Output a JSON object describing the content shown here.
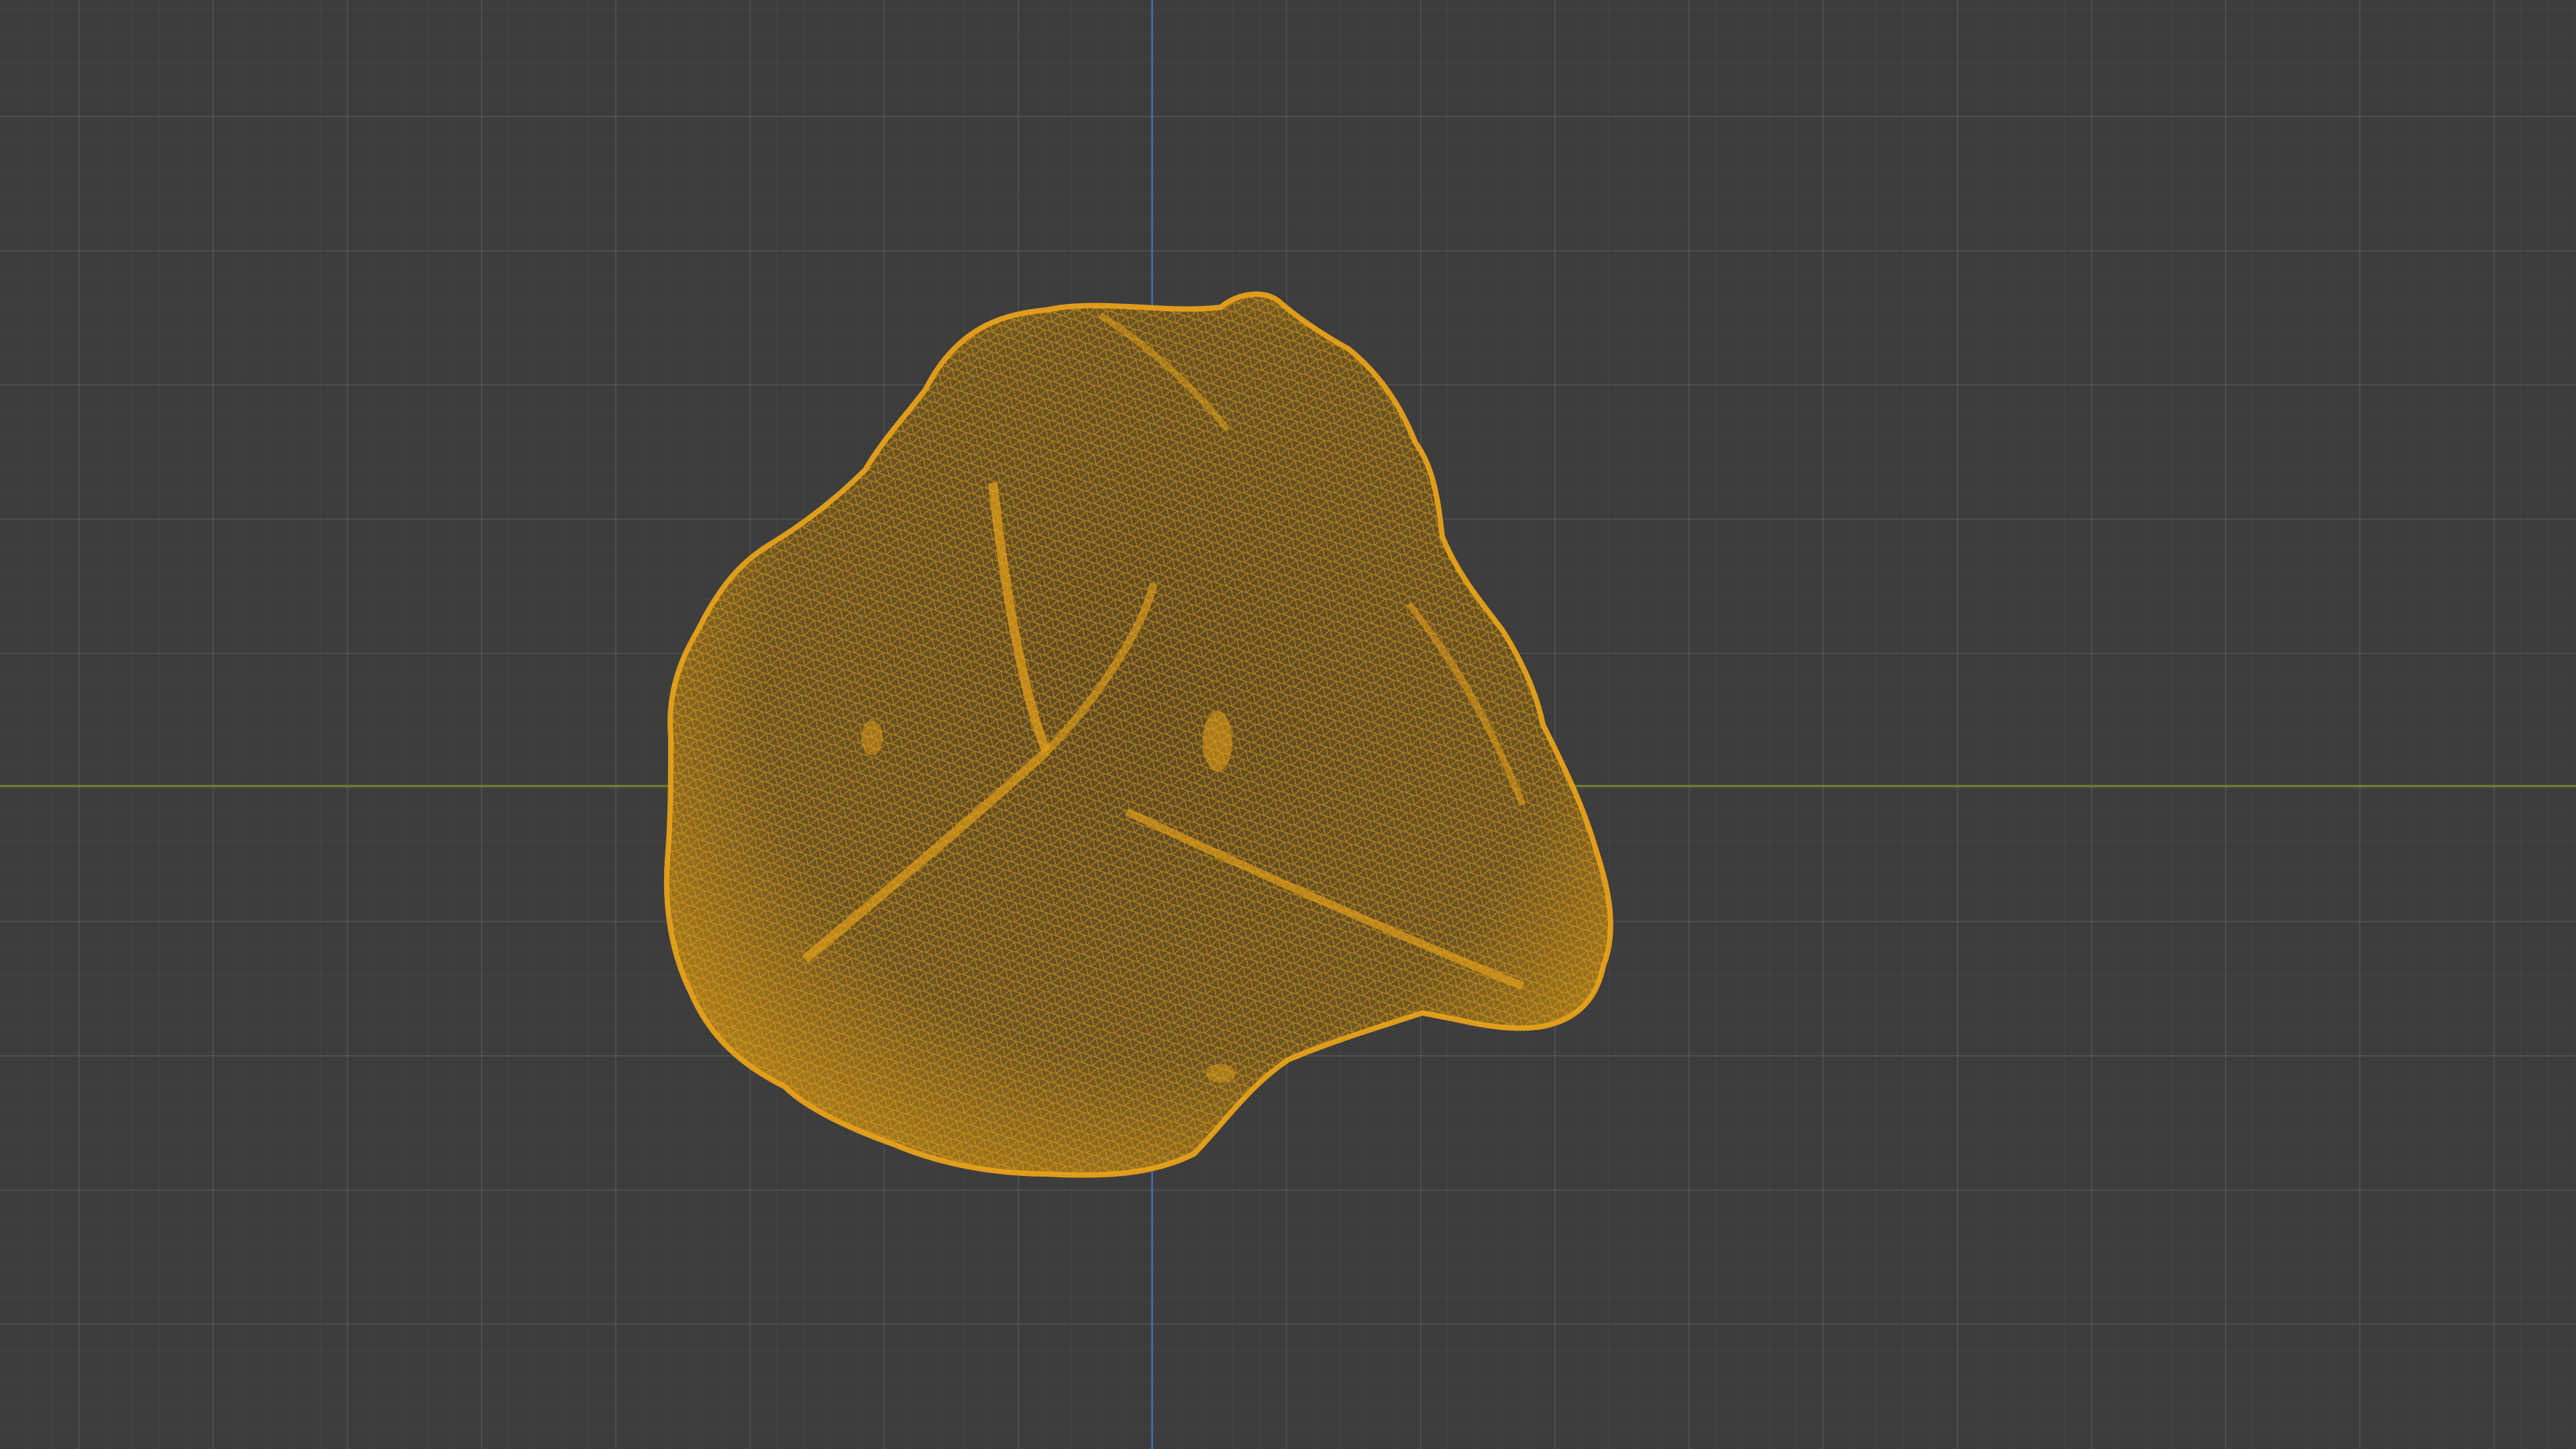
{
  "viewport": {
    "background_color": "#3d3d3d",
    "grid_visible": true,
    "x_axis_color": "#6b7f2a",
    "z_axis_color": "#3f6aa6"
  },
  "object": {
    "type": "wireframe-mesh",
    "shape": "rock",
    "selected": true,
    "wire_color": "#e6a11a",
    "fill_color": "#5a4622"
  }
}
